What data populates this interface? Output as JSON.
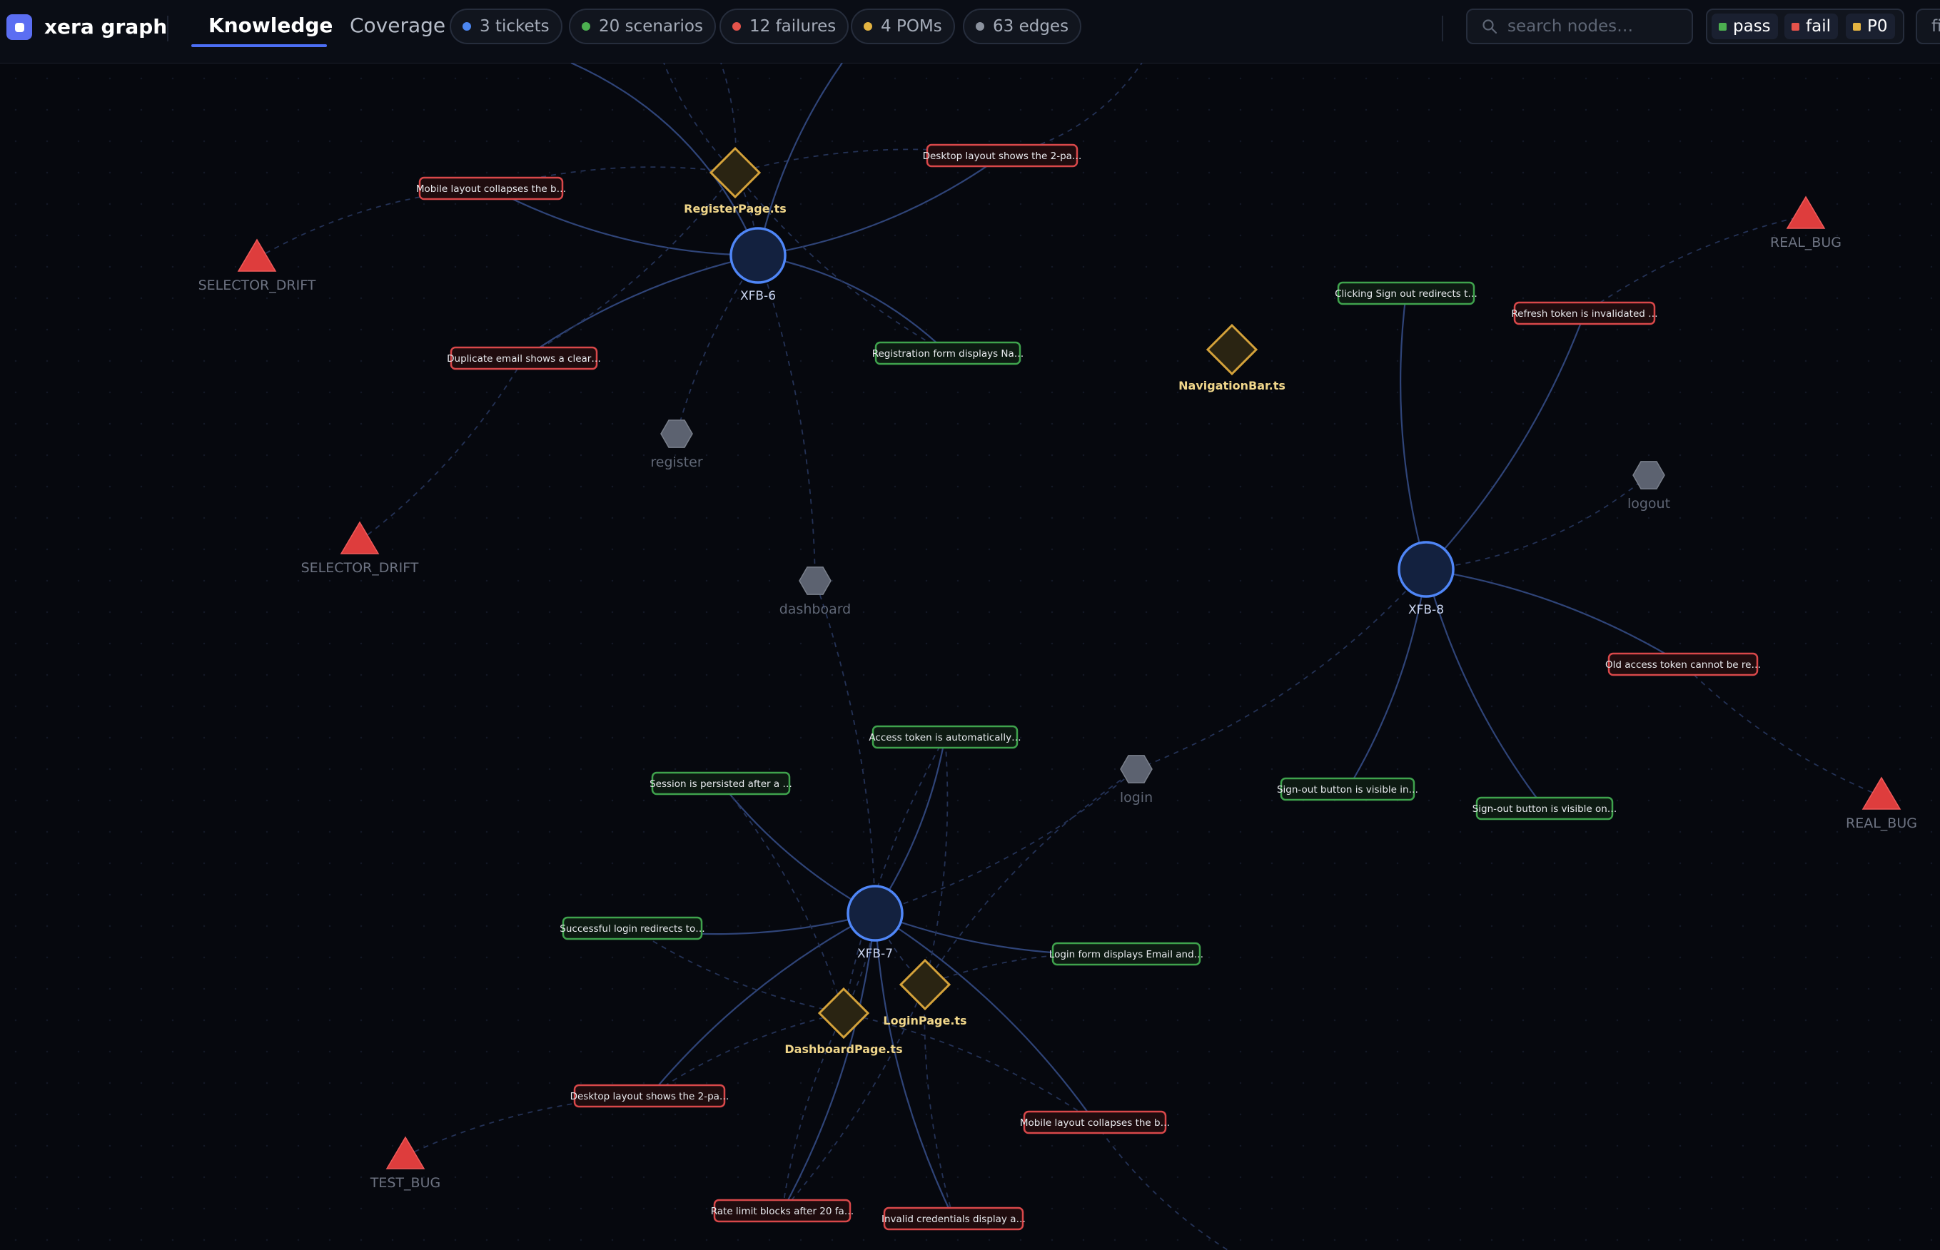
{
  "app": {
    "title": "xera graph"
  },
  "tabs": [
    {
      "label": "Knowledge",
      "active": true
    },
    {
      "label": "Coverage",
      "active": false
    }
  ],
  "stats": [
    {
      "label": "3 tickets",
      "color": "#4c86f0"
    },
    {
      "label": "20 scenarios",
      "color": "#4caf50"
    },
    {
      "label": "12 failures",
      "color": "#e5534b"
    },
    {
      "label": "4 POMs",
      "color": "#e3b341"
    },
    {
      "label": "63 edges",
      "color": "#8b929e"
    }
  ],
  "search": {
    "placeholder": "search nodes…"
  },
  "legend": [
    {
      "label": "pass",
      "color": "#4caf50"
    },
    {
      "label": "fail",
      "color": "#e5534b"
    },
    {
      "label": "P0",
      "color": "#e3b341"
    }
  ],
  "toolbar": {
    "cut_label": "fi"
  },
  "colors": {
    "background": "#06080e",
    "ticket_fill": "#13213f",
    "ticket_stroke": "#4f86f7",
    "pom_fill": "#2a2412",
    "pom_stroke": "#d4a23a",
    "pass_stroke": "#3fa34d",
    "fail_stroke": "#d9484a",
    "bug_fill": "#de3d3d",
    "step_fill": "#5c6270",
    "edge": "#2a3a66"
  },
  "graph": {
    "tickets": [
      {
        "id": "t6",
        "label": "XFB-6"
      },
      {
        "id": "t8",
        "label": "XFB-8"
      },
      {
        "id": "t7",
        "label": "XFB-7"
      }
    ],
    "poms": [
      {
        "id": "p_reg",
        "label": "RegisterPage.ts"
      },
      {
        "id": "p_nav",
        "label": "NavigationBar.ts"
      },
      {
        "id": "p_login",
        "label": "LoginPage.ts"
      },
      {
        "id": "p_dash",
        "label": "DashboardPage.ts"
      }
    ],
    "steps": [
      {
        "id": "s_reg",
        "label": "register"
      },
      {
        "id": "s_dash",
        "label": "dashboard"
      },
      {
        "id": "s_login",
        "label": "login"
      },
      {
        "id": "s_logout",
        "label": "logout"
      }
    ],
    "bugs": [
      {
        "id": "b1",
        "label": "SELECTOR_DRIFT"
      },
      {
        "id": "b2",
        "label": "SELECTOR_DRIFT"
      },
      {
        "id": "b3",
        "label": "REAL_BUG"
      },
      {
        "id": "b4",
        "label": "REAL_BUG"
      },
      {
        "id": "b5",
        "label": "TEST_BUG"
      }
    ],
    "scenarios": [
      {
        "id": "c1",
        "label": "Mobile layout collapses the b…",
        "status": "fail"
      },
      {
        "id": "c2",
        "label": "Desktop layout shows the 2-pa…",
        "status": "fail"
      },
      {
        "id": "c3",
        "label": "Duplicate email shows a clear…",
        "status": "fail"
      },
      {
        "id": "c4",
        "label": "Registration form displays Na…",
        "status": "pass"
      },
      {
        "id": "c5",
        "label": "Clicking Sign out redirects t…",
        "status": "pass"
      },
      {
        "id": "c6",
        "label": "Refresh token is invalidated …",
        "status": "fail"
      },
      {
        "id": "c7",
        "label": "Old access token cannot be re…",
        "status": "fail"
      },
      {
        "id": "c8",
        "label": "Sign-out button is visible in…",
        "status": "pass"
      },
      {
        "id": "c9",
        "label": "Sign-out button is visible on…",
        "status": "pass"
      },
      {
        "id": "c10",
        "label": "Access token is automatically…",
        "status": "pass"
      },
      {
        "id": "c11",
        "label": "Session is persisted after a …",
        "status": "pass"
      },
      {
        "id": "c12",
        "label": "Successful login redirects to…",
        "status": "pass"
      },
      {
        "id": "c13",
        "label": "Login form displays Email and…",
        "status": "pass"
      },
      {
        "id": "c14",
        "label": "Desktop layout shows the 2-pa…",
        "status": "fail"
      },
      {
        "id": "c15",
        "label": "Mobile layout collapses the b…",
        "status": "fail"
      },
      {
        "id": "c16",
        "label": "Rate limit blocks after 20 fa…",
        "status": "fail"
      },
      {
        "id": "c17",
        "label": "Invalid credentials display a…",
        "status": "fail"
      }
    ]
  }
}
